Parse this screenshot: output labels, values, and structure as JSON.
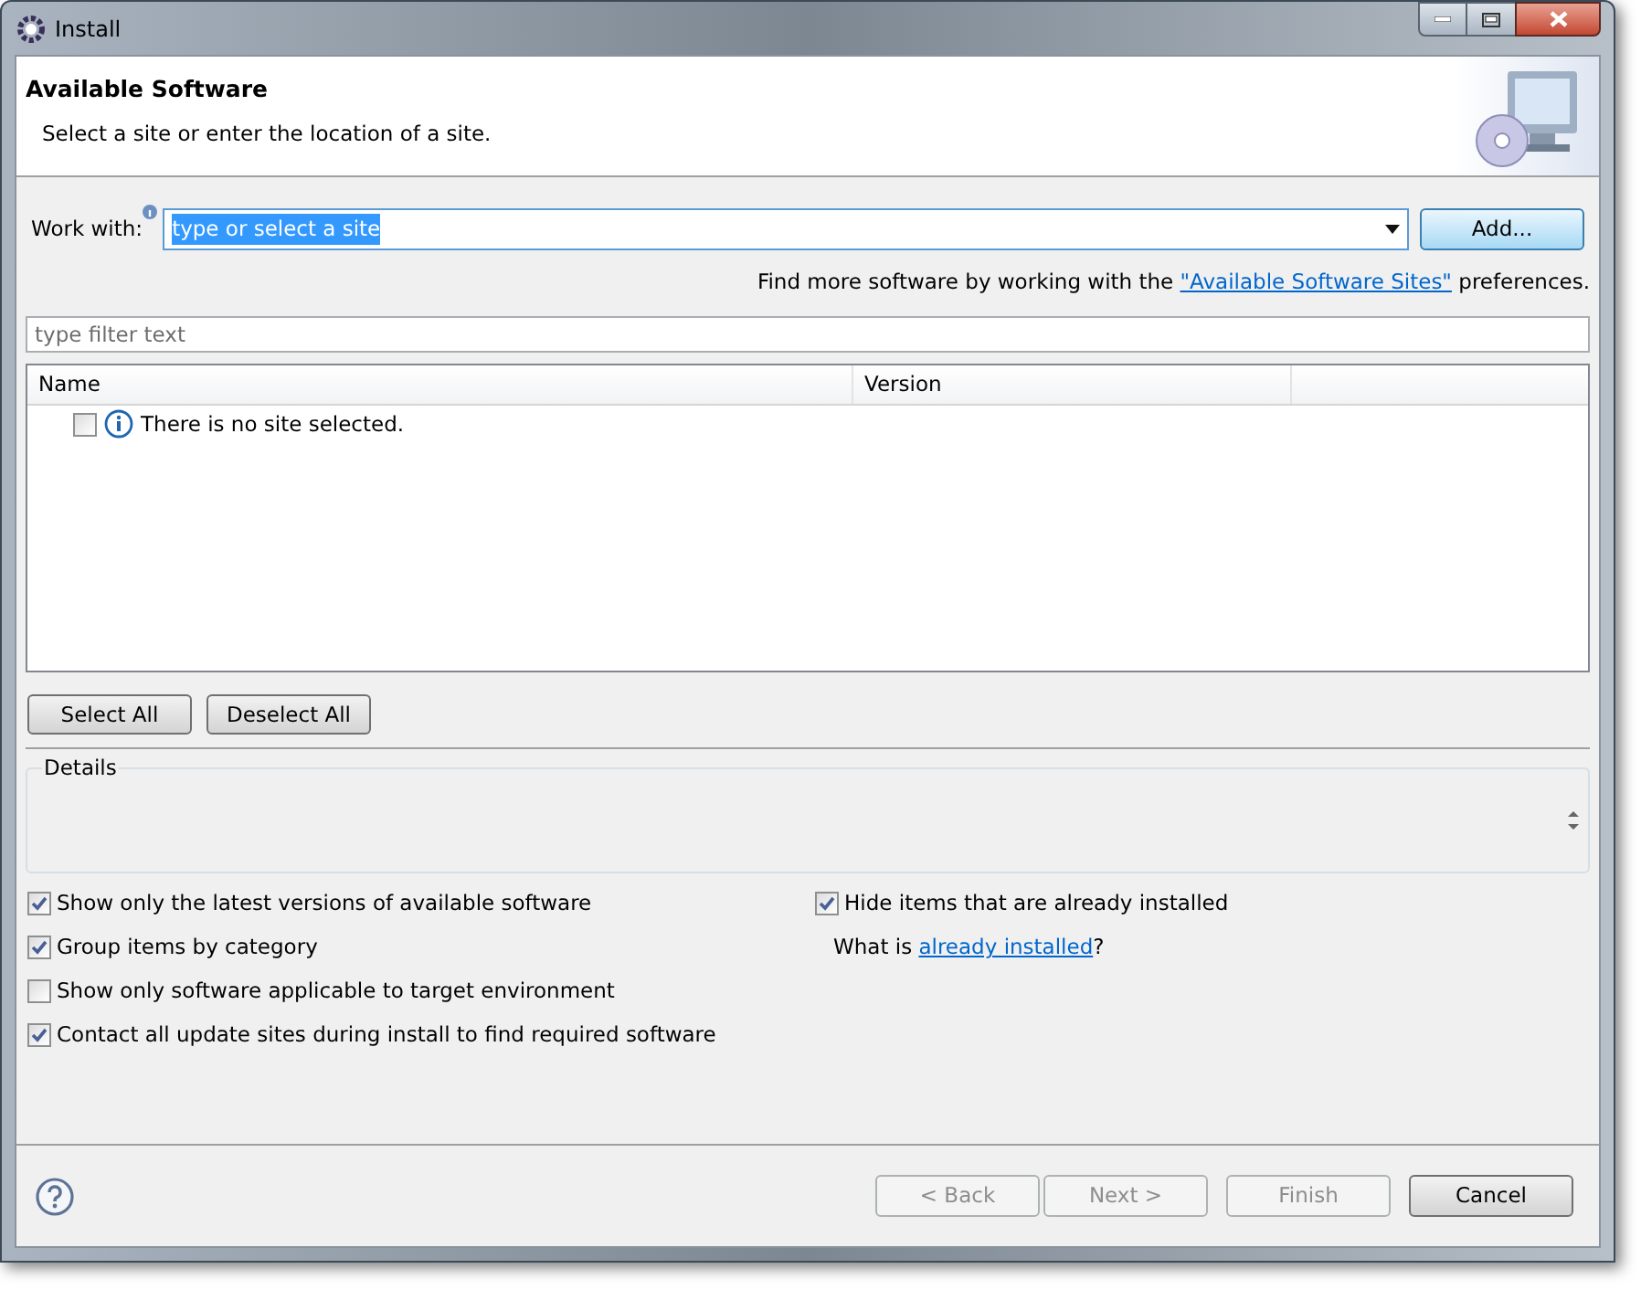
{
  "window": {
    "title": "Install"
  },
  "header": {
    "title": "Available Software",
    "subtitle": "Select a site or enter the location of a site."
  },
  "work_with": {
    "label": "Work with:",
    "value": "type or select a site",
    "text_selected": true,
    "add_button": "Add..."
  },
  "sites_note": {
    "before": "Find more software by working with the ",
    "link": "\"Available Software Sites\"",
    "after": " preferences."
  },
  "filter": {
    "placeholder": "type filter text"
  },
  "table": {
    "columns": [
      "Name",
      "Version"
    ],
    "rows": [
      {
        "checked": false,
        "text": "There is no site selected."
      }
    ]
  },
  "selection_buttons": [
    "Select All",
    "Deselect All"
  ],
  "details": {
    "label": "Details"
  },
  "options_left": [
    {
      "label": "Show only the latest versions of available software",
      "checked": true
    },
    {
      "label": "Group items by category",
      "checked": true
    },
    {
      "label": "Show only software applicable to target environment",
      "checked": false
    },
    {
      "label": "Contact all update sites during install to find required software",
      "checked": true
    }
  ],
  "options_right": [
    {
      "label": "Hide items that are already installed",
      "checked": true
    }
  ],
  "installed_note": {
    "before": "What is ",
    "link": "already installed",
    "after": "?"
  },
  "footer_buttons": [
    {
      "label": "< Back",
      "disabled": true
    },
    {
      "label": "Next >",
      "disabled": true
    },
    {
      "label": "Finish",
      "disabled": true
    },
    {
      "label": "Cancel",
      "disabled": false
    }
  ]
}
